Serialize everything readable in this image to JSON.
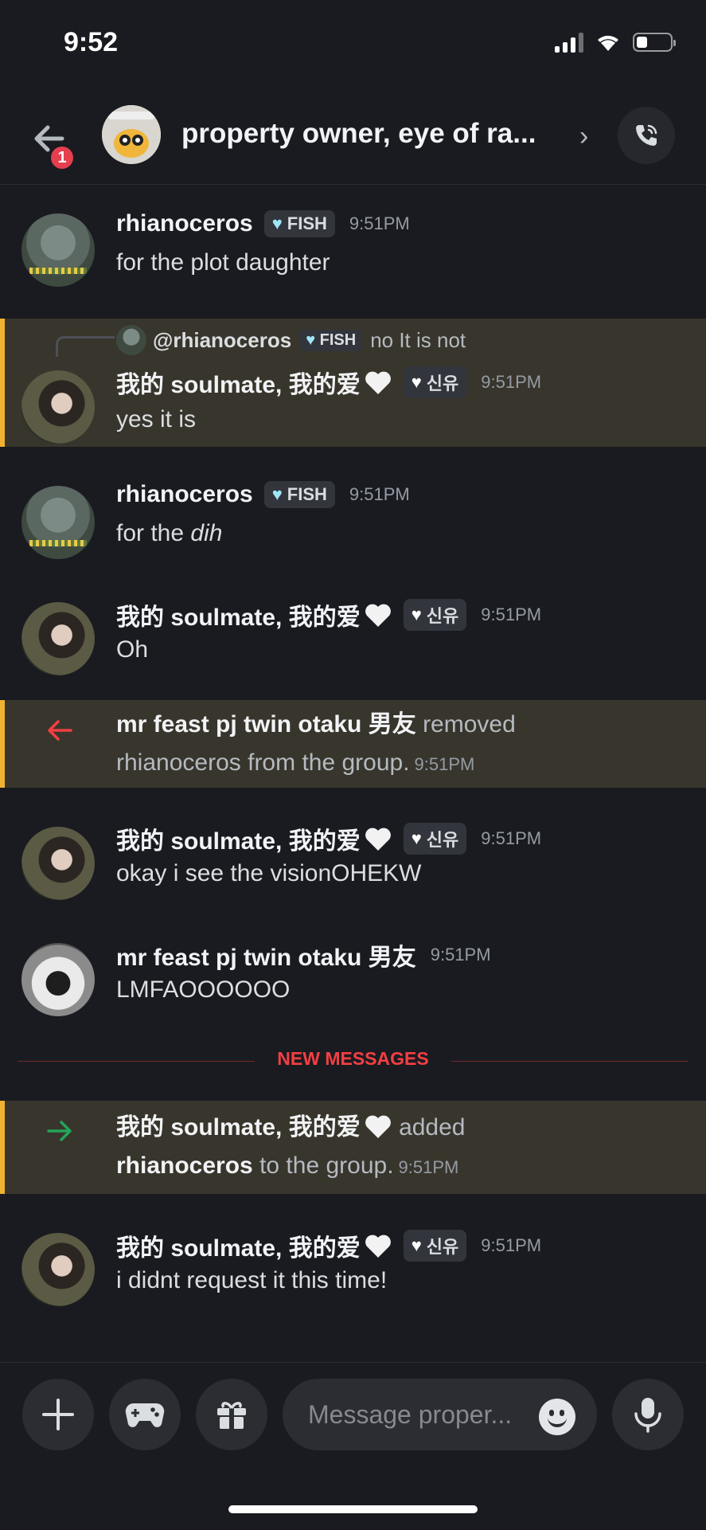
{
  "status": {
    "time": "9:52"
  },
  "header": {
    "badge": "1",
    "title": "property owner, eye of ra...",
    "chevron": "›"
  },
  "messages": [
    {
      "author": "rhianoceros",
      "tag": "FISH",
      "time": "9:51PM",
      "text": "for the plot daughter"
    },
    {
      "reply": {
        "name": "@rhianoceros",
        "tag": "FISH",
        "text": "no It is not"
      },
      "author": "我的 soulmate, 我的爱",
      "tag": "신유",
      "time": "9:51PM",
      "text": "yes it is"
    },
    {
      "author": "rhianoceros",
      "tag": "FISH",
      "time": "9:51PM",
      "text_prefix": "for the ",
      "text_italic": "dih"
    },
    {
      "author": "我的 soulmate, 我的爱",
      "tag": "신유",
      "time": "9:51PM",
      "text": "Oh"
    },
    {
      "actor": "mr feast pj twin otaku 男友",
      "action": "removed",
      "target": "rhianoceros",
      "suffix": "from the group.",
      "time": "9:51PM"
    },
    {
      "author": "我的 soulmate, 我的爱",
      "tag": "신유",
      "time": "9:51PM",
      "text": "okay i see the visionOHEKW"
    },
    {
      "author": "mr feast pj twin otaku 男友",
      "time": "9:51PM",
      "text": "LMFAOOOOOO"
    },
    {
      "actor": "我的 soulmate, 我的爱",
      "action": "added",
      "target": "rhianoceros",
      "suffix": "to the group.",
      "time": "9:51PM"
    },
    {
      "author": "我的 soulmate, 我的爱",
      "tag": "신유",
      "time": "9:51PM",
      "text": "i didnt request it this time!"
    }
  ],
  "divider": {
    "label": "NEW MESSAGES"
  },
  "composer": {
    "placeholder": "Message proper..."
  },
  "colors": {
    "accent_red": "#f23f43",
    "highlight": "#38352c",
    "mention_bar": "#f0b232",
    "join_green": "#23a55a"
  },
  "icons": [
    "back-arrow-icon",
    "call-icon",
    "plus-icon",
    "gamepad-icon",
    "gift-icon",
    "emoji-icon",
    "microphone-icon",
    "white-heart-icon",
    "signal-icon",
    "wifi-icon",
    "battery-icon"
  ]
}
